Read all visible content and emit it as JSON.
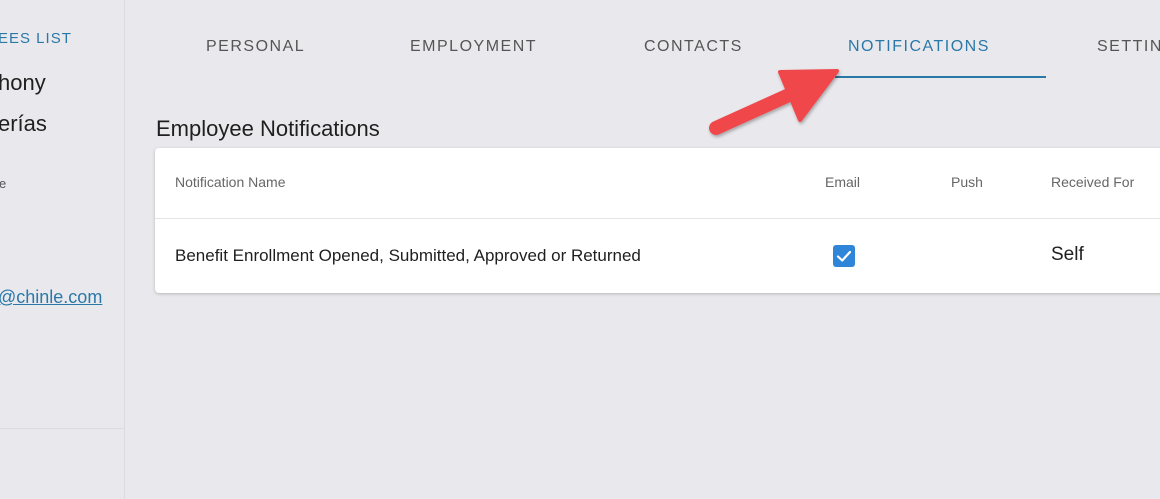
{
  "sidebar": {
    "back_link": "EES LIST",
    "employee_name_line1": "hony",
    "employee_name_line2": "erías",
    "employee_sub": "e",
    "employee_email": "@chinle.com"
  },
  "tabs": [
    {
      "label": "PERSONAL"
    },
    {
      "label": "EMPLOYMENT"
    },
    {
      "label": "CONTACTS"
    },
    {
      "label": "NOTIFICATIONS",
      "active": true
    },
    {
      "label": "SETTIN"
    }
  ],
  "section_title": "Employee Notifications",
  "table": {
    "headers": {
      "name": "Notification Name",
      "email": "Email",
      "push": "Push",
      "received_for": "Received For"
    },
    "rows": [
      {
        "name": "Benefit Enrollment Opened, Submitted, Approved or Returned",
        "email_checked": true,
        "push_checked": false,
        "received_for": "Self"
      }
    ]
  },
  "colors": {
    "accent": "#2a78a8",
    "checkbox": "#2f86d8",
    "annotation_arrow": "#f0474c",
    "background": "#e9e9ed"
  }
}
